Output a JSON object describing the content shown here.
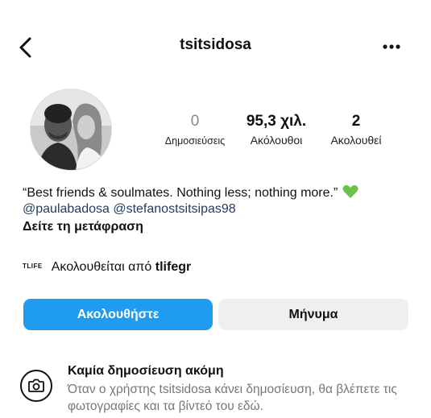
{
  "header": {
    "username": "tsitsidosa",
    "back_icon": "chevron-left-icon",
    "more_icon": "more-horizontal-icon"
  },
  "profile": {
    "avatar_icon": "profile-photo",
    "stats": {
      "posts": {
        "value": "0",
        "label": "Δημοσιεύσεις"
      },
      "followers": {
        "value": "95,3 χιλ.",
        "label": "Ακόλουθοι"
      },
      "following": {
        "value": "2",
        "label": "Ακολουθεί"
      }
    },
    "bio": "“Best friends & soulmates. Nothing less; nothing more.”",
    "bio_emoji_icon": "green-heart-icon",
    "mentions": [
      "@paulabadosa",
      "@stefanostsitsipas98"
    ],
    "see_translation": "Δείτε τη μετάφραση",
    "followed_by": {
      "logo_text": "TLIFE",
      "prefix": "Ακολουθείται από",
      "account": "tlifegr"
    }
  },
  "actions": {
    "follow": "Ακολουθήστε",
    "message": "Μήνυμα"
  },
  "empty_state": {
    "icon": "camera-icon",
    "title": "Καμία δημοσίευση ακόμη",
    "text": "Όταν ο χρήστης tsitsidosa κάνει δημοσίευση, θα βλέπετε τις φωτογραφίες και τα βίντεό του εδώ."
  },
  "colors": {
    "accent": "#1f9cf0",
    "secondary_button": "#efefef",
    "mention": "#1e3a5f",
    "muted": "#777777"
  }
}
